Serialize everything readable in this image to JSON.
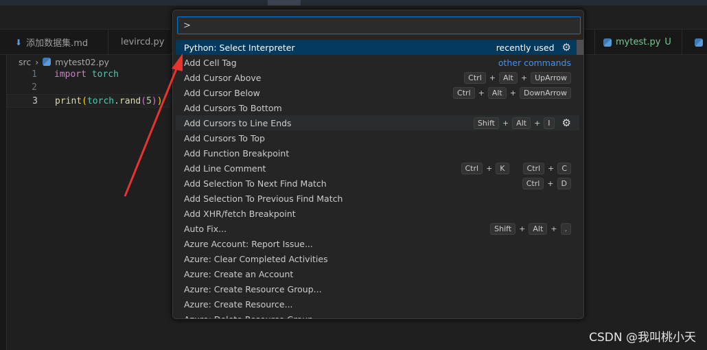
{
  "tabs": [
    {
      "label": "添加数据集.md",
      "icon": "download-icon"
    },
    {
      "label": "levircd.py",
      "icon": "python-icon"
    },
    {
      "label": "mytest.py",
      "status": "U",
      "icon": "python-icon",
      "color": "#73c991"
    }
  ],
  "breadcrumb": {
    "folder": "src",
    "file": "mytest02.py"
  },
  "editor": {
    "lines": [
      {
        "n": "1",
        "tokens": [
          {
            "t": "import",
            "c": "kw"
          },
          {
            "t": " "
          },
          {
            "t": "torch",
            "c": "mod"
          }
        ]
      },
      {
        "n": "2",
        "tokens": []
      },
      {
        "n": "3",
        "tokens": [
          {
            "t": "print",
            "c": "fn"
          },
          {
            "t": "(",
            "c": "p1"
          },
          {
            "t": "torch",
            "c": "mod"
          },
          {
            "t": "."
          },
          {
            "t": "rand",
            "c": "fn"
          },
          {
            "t": "(",
            "c": "p2"
          },
          {
            "t": "5",
            "c": "num"
          },
          {
            "t": ")",
            "c": "p2"
          },
          {
            "t": ")",
            "c": "p1"
          }
        ]
      }
    ]
  },
  "palette": {
    "input_value": ">",
    "items": [
      {
        "label": "Python: Select Interpreter",
        "selected": true,
        "tag": "recently used",
        "gear": true
      },
      {
        "label": "Add Cell Tag",
        "link": "other commands"
      },
      {
        "label": "Add Cursor Above",
        "keys": [
          [
            "Ctrl",
            "Alt",
            "UpArrow"
          ]
        ]
      },
      {
        "label": "Add Cursor Below",
        "keys": [
          [
            "Ctrl",
            "Alt",
            "DownArrow"
          ]
        ]
      },
      {
        "label": "Add Cursors To Bottom"
      },
      {
        "label": "Add Cursors to Line Ends",
        "hover": true,
        "keys": [
          [
            "Shift",
            "Alt",
            "I"
          ]
        ],
        "gear": true
      },
      {
        "label": "Add Cursors To Top"
      },
      {
        "label": "Add Function Breakpoint"
      },
      {
        "label": "Add Line Comment",
        "keys": [
          [
            "Ctrl",
            "K"
          ],
          [
            "Ctrl",
            "C"
          ]
        ]
      },
      {
        "label": "Add Selection To Next Find Match",
        "keys": [
          [
            "Ctrl",
            "D"
          ]
        ]
      },
      {
        "label": "Add Selection To Previous Find Match"
      },
      {
        "label": "Add XHR/fetch Breakpoint"
      },
      {
        "label": "Auto Fix...",
        "keys": [
          [
            "Shift",
            "Alt",
            "."
          ]
        ]
      },
      {
        "label": "Azure Account: Report Issue..."
      },
      {
        "label": "Azure: Clear Completed Activities"
      },
      {
        "label": "Azure: Create an Account"
      },
      {
        "label": "Azure: Create Resource Group..."
      },
      {
        "label": "Azure: Create Resource..."
      },
      {
        "label": "Azure: Delete Resource Group..."
      }
    ]
  },
  "watermark": "CSDN @我叫桃小天",
  "colors": {
    "accent": "#0078d4",
    "selection": "#04395e",
    "annotation_arrow": "#e8342f"
  }
}
